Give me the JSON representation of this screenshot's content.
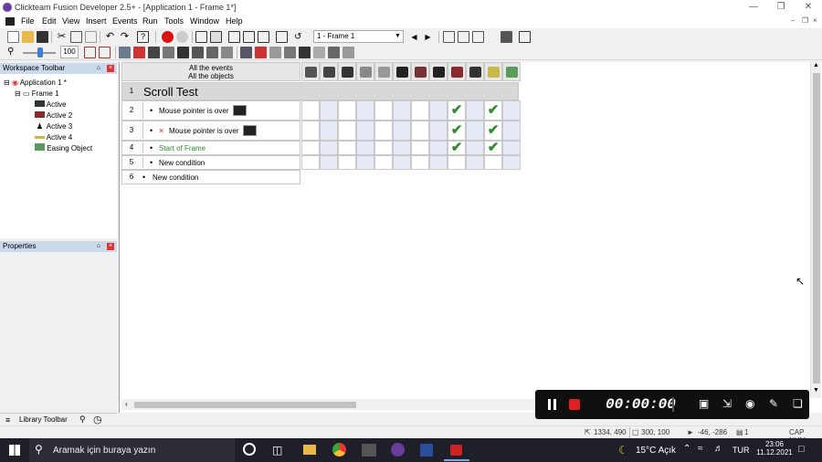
{
  "title": "Clickteam Fusion Developer 2.5+ - [Application 1 - Frame 1*]",
  "menu": [
    "File",
    "Edit",
    "View",
    "Insert",
    "Events",
    "Run",
    "Tools",
    "Window",
    "Help"
  ],
  "frame_combo": "1 - Frame 1",
  "zoom_value": "100",
  "workspace": {
    "title": "Workspace Toolbar",
    "app": "Application 1 *",
    "frame": "Frame 1",
    "objects": [
      "Active",
      "Active 2",
      "Active 3",
      "Active 4",
      "Easing Object"
    ]
  },
  "properties_title": "Properties",
  "library_title": "Library Toolbar",
  "event_editor": {
    "header_line1": "All the events",
    "header_line2": "All the objects",
    "rows": [
      {
        "num": "1",
        "text": "Scroll Test",
        "kind": "comment"
      },
      {
        "num": "2",
        "text": "Mouse pointer is over",
        "kind": "condition",
        "neg": false,
        "checks": [
          9,
          11
        ]
      },
      {
        "num": "3",
        "text": "Mouse pointer is over",
        "kind": "condition",
        "neg": true,
        "checks": [
          9,
          11
        ]
      },
      {
        "num": "4",
        "text": "Start of Frame",
        "kind": "start",
        "checks": [
          9,
          11
        ]
      },
      {
        "num": "5",
        "text": "New condition",
        "kind": "newcond"
      },
      {
        "num": "6",
        "text": "New condition",
        "kind": "newevent"
      }
    ]
  },
  "status": {
    "coords": "1334, 490",
    "size": "300, 100",
    "mouse": "-46, -286",
    "count": "1",
    "caps": "CAP NUM"
  },
  "recorder": {
    "time": "00:00:00"
  },
  "taskbar": {
    "search_placeholder": "Aramak için buraya yazın",
    "weather": "15°C  Açık",
    "lang": "TUR",
    "time": "23:06",
    "date": "11.12.2021"
  },
  "colors": {
    "accent": "#cbd9ec",
    "check": "#2e8b2e",
    "start_green": "#2e8b2e",
    "comment_bg": "#d8d8d8"
  }
}
